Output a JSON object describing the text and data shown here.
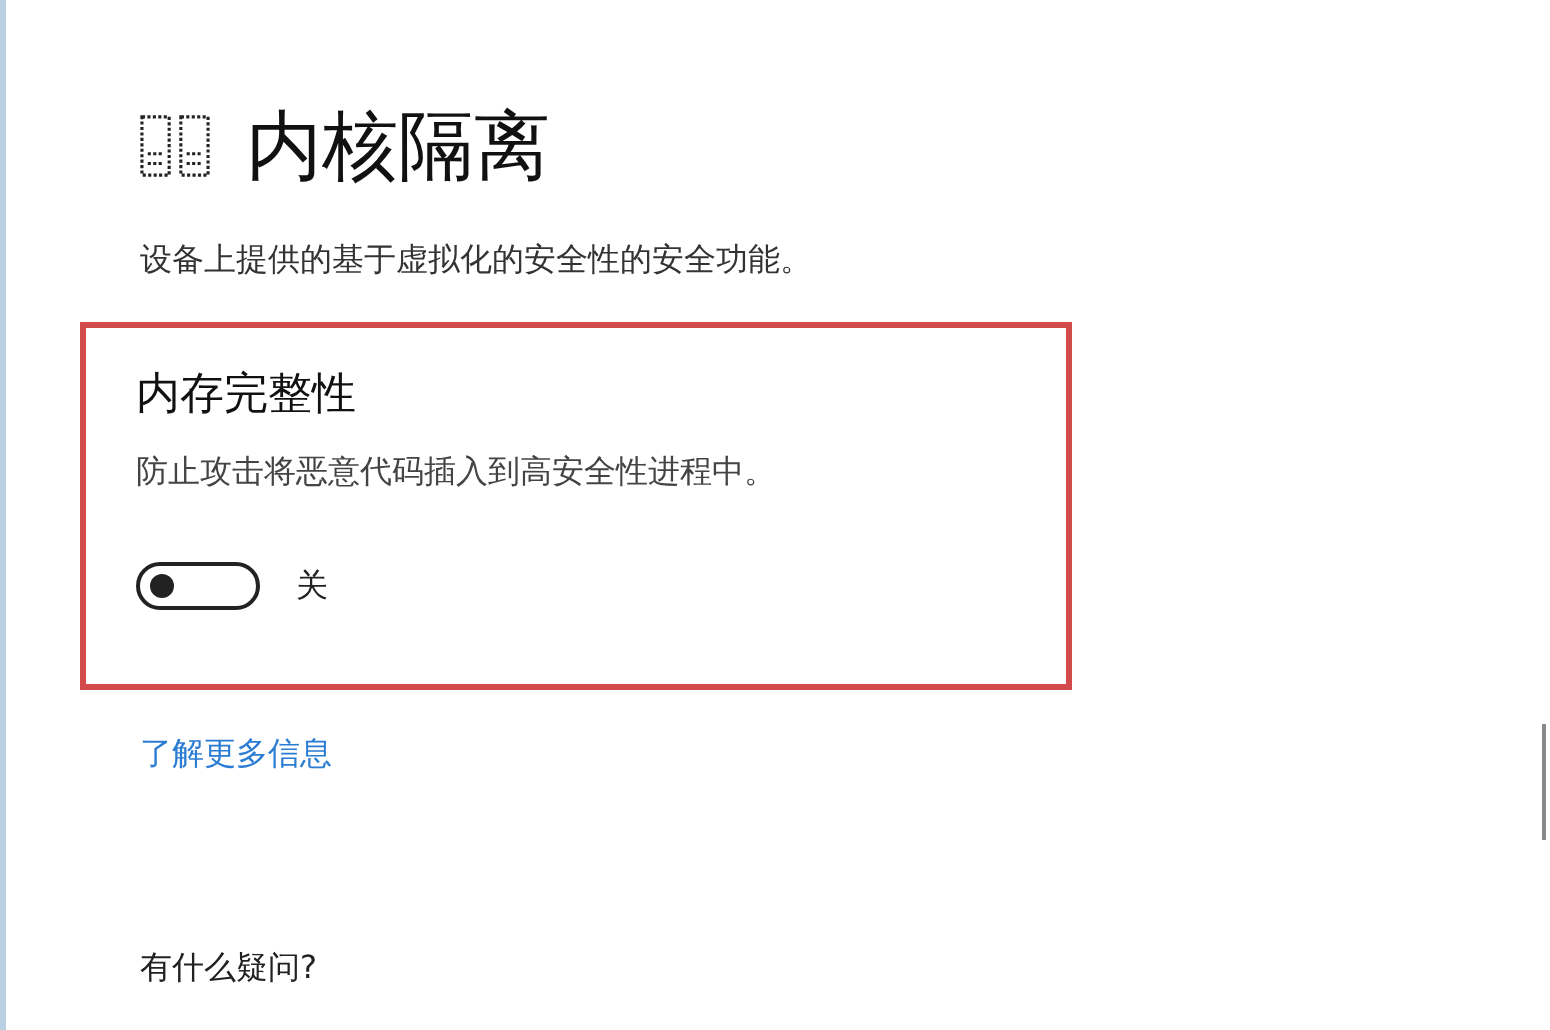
{
  "page": {
    "title": "内核隔离",
    "description": "设备上提供的基于虚拟化的安全性的安全功能。"
  },
  "setting": {
    "title": "内存完整性",
    "description": "防止攻击将恶意代码插入到高安全性进程中。",
    "highlighted": true,
    "toggle": {
      "on": false,
      "label": "关"
    }
  },
  "link": "了解更多信息",
  "help_heading": "有什么疑问?"
}
